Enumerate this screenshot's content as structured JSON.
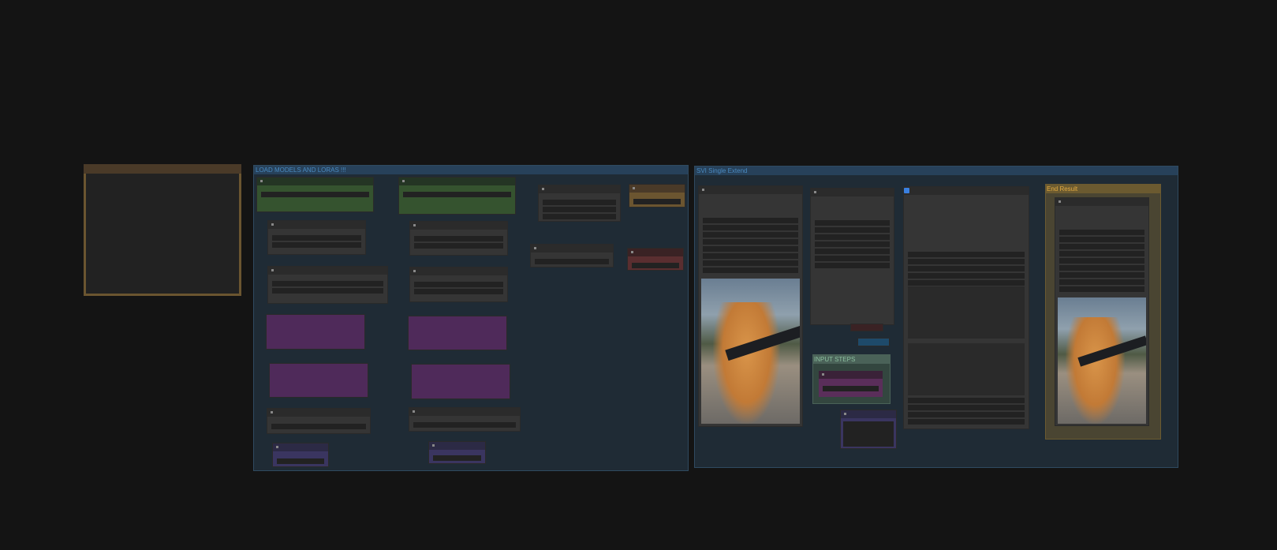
{
  "groups": {
    "load_models": "LOAD MODELS AND LORAS !!!",
    "svi": "SVI Single Extend",
    "end_result": "End Result",
    "input_steps": "INPUT STEPS"
  },
  "colors": {
    "canvas": "#141414",
    "group": "#1f2b35",
    "node": "#353535",
    "lora": "#4f2a5a",
    "loader": "#35532f"
  }
}
